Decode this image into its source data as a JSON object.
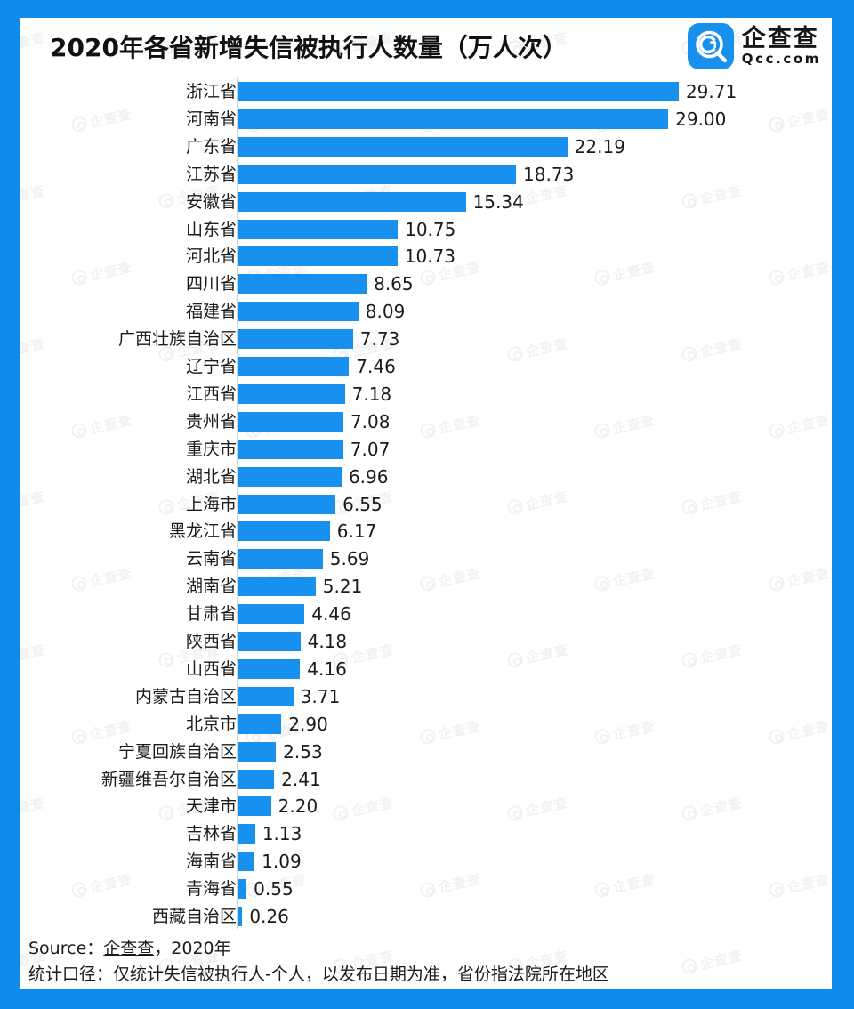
{
  "header": {
    "title": "2020年各省新增失信被执行人数量（万人次）",
    "logo": {
      "cn": "企查查",
      "en": "Qcc.com",
      "mark_icon": "qcc-search-logo-icon",
      "brand_color": "#1890ee"
    }
  },
  "footer": {
    "source_prefix": "Source：",
    "source_link": "企查查",
    "source_suffix": "，2020年",
    "note": "统计口径：仅统计失信被执行人-个人，以发布日期为准，省份指法院所在地区"
  },
  "colors": {
    "frame": "#0E8BEF",
    "bar": "#1890ee",
    "axis": "#d4d4d4",
    "text": "#1b1b1b"
  },
  "chart_data": {
    "type": "bar",
    "orientation": "horizontal",
    "title": "2020年各省新增失信被执行人数量（万人次）",
    "xlabel": "",
    "ylabel": "",
    "unit": "万人次",
    "grid": false,
    "legend": false,
    "xlim": [
      0,
      29.71
    ],
    "value_format": "0.00",
    "categories": [
      "浙江省",
      "河南省",
      "广东省",
      "江苏省",
      "安徽省",
      "山东省",
      "河北省",
      "四川省",
      "福建省",
      "广西壮族自治区",
      "辽宁省",
      "江西省",
      "贵州省",
      "重庆市",
      "湖北省",
      "上海市",
      "黑龙江省",
      "云南省",
      "湖南省",
      "甘肃省",
      "陕西省",
      "山西省",
      "内蒙古自治区",
      "北京市",
      "宁夏回族自治区",
      "新疆维吾尔自治区",
      "天津市",
      "吉林省",
      "海南省",
      "青海省",
      "西藏自治区"
    ],
    "values": [
      29.71,
      29.0,
      22.19,
      18.73,
      15.34,
      10.75,
      10.73,
      8.65,
      8.09,
      7.73,
      7.46,
      7.18,
      7.08,
      7.07,
      6.96,
      6.55,
      6.17,
      5.69,
      5.21,
      4.46,
      4.18,
      4.16,
      3.71,
      2.9,
      2.53,
      2.41,
      2.2,
      1.13,
      1.09,
      0.55,
      0.26
    ],
    "labels": [
      "29.71",
      "29.00",
      "22.19",
      "18.73",
      "15.34",
      "10.75",
      "10.73",
      "8.65",
      "8.09",
      "7.73",
      "7.46",
      "7.18",
      "7.08",
      "7.07",
      "6.96",
      "6.55",
      "6.17",
      "5.69",
      "5.21",
      "4.46",
      "4.18",
      "4.16",
      "3.71",
      "2.90",
      "2.53",
      "2.41",
      "2.20",
      "1.13",
      "1.09",
      "0.55",
      "0.26"
    ]
  }
}
